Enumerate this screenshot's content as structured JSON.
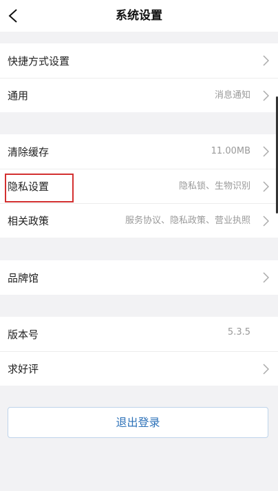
{
  "header": {
    "title": "系统设置",
    "back_icon": "back-chevron-icon"
  },
  "groups": [
    {
      "rows": [
        {
          "label": "快捷方式设置",
          "value": ""
        },
        {
          "label": "通用",
          "value": "消息通知"
        }
      ]
    },
    {
      "rows": [
        {
          "label": "清除缓存",
          "value": "11.00MB"
        },
        {
          "label": "隐私设置",
          "value": "隐私锁、生物识别"
        },
        {
          "label": "相关政策",
          "value": "服务协议、隐私政策、营业执照"
        }
      ]
    },
    {
      "rows": [
        {
          "label": "品牌馆",
          "value": ""
        }
      ]
    },
    {
      "rows": [
        {
          "label": "版本号",
          "value": "5.3.5"
        },
        {
          "label": "求好评",
          "value": ""
        }
      ]
    }
  ],
  "logout_label": "退出登录",
  "colors": {
    "accent": "#2c71b8",
    "highlight": "#d32f2f"
  }
}
